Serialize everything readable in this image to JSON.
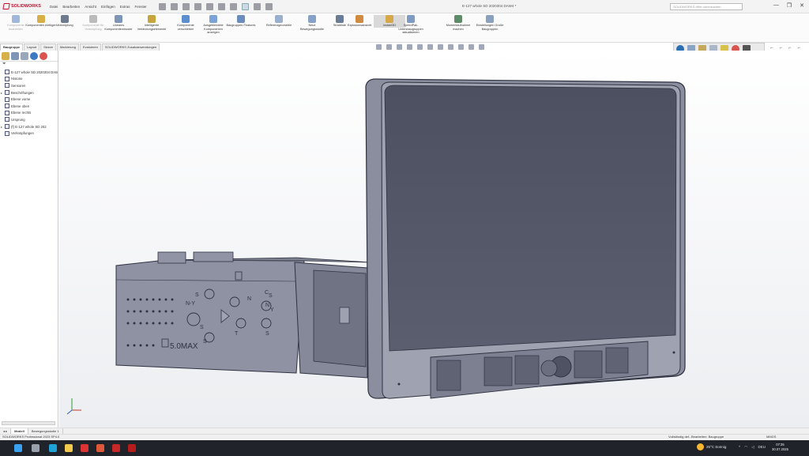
{
  "app": {
    "brand": "SOLIDWORKS",
    "menus": [
      "Datei",
      "Bearbeiten",
      "Ansicht",
      "Einfügen",
      "Extras",
      "Fenster"
    ],
    "document_title": "E-127 whole SD 2020304 DAW4 *",
    "search_placeholder": "SOLIDWORKS-Hilfe durchsuchen",
    "window_controls": [
      "—",
      "❐",
      "✕"
    ]
  },
  "command_manager": {
    "tools": [
      {
        "label": "Komponente bearbeiten",
        "disabled": true,
        "color": "#9fb7d9"
      },
      {
        "label": "Komponenten einfügen",
        "disabled": false,
        "color": "#d8b04a"
      },
      {
        "label": "Verknüpfung",
        "disabled": false,
        "color": "#6d7b91"
      },
      {
        "label": "Komponente für Verknüpfung",
        "disabled": true,
        "color": "#bbbbbb"
      },
      {
        "label": "Lineares Komponentenmuster",
        "disabled": false,
        "color": "#7f95b8"
      },
      {
        "label": "Intelligente Verbindungselemente",
        "disabled": false,
        "color": "#c7a53c"
      },
      {
        "label": "Komponente verschieben",
        "disabled": false,
        "color": "#5b8fcf"
      },
      {
        "label": "Ausgeblendete Komponenten anzeigen",
        "disabled": false,
        "color": "#7aa3d8"
      },
      {
        "label": "Baugruppen-Features",
        "disabled": false,
        "color": "#6a8dbe"
      },
      {
        "label": "Referenzgeometrie",
        "disabled": false,
        "color": "#9ab0cf"
      },
      {
        "label": "Neue Bewegungsstudie",
        "disabled": false,
        "color": "#87a2c7"
      },
      {
        "label": "Stückliste",
        "disabled": false,
        "color": "#6a7d96"
      },
      {
        "label": "Explosionsansicht",
        "disabled": false,
        "color": "#d08b3e"
      },
      {
        "label": "Instant3D",
        "disabled": false,
        "active": true,
        "color": "#d6a84a"
      },
      {
        "label": "SpeedPak-Untersbaugruppen aktualisieren",
        "disabled": false,
        "color": "#7f9bc2"
      },
      {
        "label": "Momentaufnahme machen",
        "disabled": false,
        "color": "#5e8c6a"
      },
      {
        "label": "Einstellungen Große Baugruppen",
        "disabled": false,
        "color": "#8aa0bf"
      }
    ]
  },
  "tabs": [
    "Baugruppe",
    "Layout",
    "Skizze",
    "Markierung",
    "Evaluieren",
    "SOLIDWORKS Zusatzanwendungen"
  ],
  "feature_tree": {
    "items": [
      {
        "label": "E-127 whole SD 2020304 DAW",
        "icon": "assembly-icon",
        "caret": ""
      },
      {
        "label": "Historie",
        "icon": "history-icon",
        "caret": ""
      },
      {
        "label": "Sensoren",
        "icon": "sensor-icon",
        "caret": ""
      },
      {
        "label": "Beschriftungen",
        "icon": "annotation-icon",
        "caret": "▸"
      },
      {
        "label": "Ebene vorne",
        "icon": "plane-icon",
        "caret": ""
      },
      {
        "label": "Ebene oben",
        "icon": "plane-icon",
        "caret": ""
      },
      {
        "label": "Ebene rechts",
        "icon": "plane-icon",
        "caret": ""
      },
      {
        "label": "Ursprung",
        "icon": "origin-icon",
        "caret": ""
      },
      {
        "label": "(f) E-127 whole SD 202",
        "icon": "part-icon",
        "caret": "▸"
      },
      {
        "label": "Verknüpfungen",
        "icon": "mates-icon",
        "caret": ""
      }
    ]
  },
  "bottom_tabs": [
    "Modell",
    "Bewegungsstudie 1"
  ],
  "status": {
    "version": "SOLIDWORKS Professional 2023 SP4.0",
    "defined": "Vollständig def...",
    "mode": "Bearbeiten: Baugruppe",
    "units": "MMGS"
  },
  "taskbar": {
    "weather": "25°C Sonnig",
    "lang": "DEU",
    "time": "07:35",
    "date": "30.07.2025",
    "apps": [
      {
        "name": "windows-start-icon",
        "color": "#3aa0f0"
      },
      {
        "name": "task-view-icon",
        "color": "#9aa0aa"
      },
      {
        "name": "edge-icon",
        "color": "#1fa2d8"
      },
      {
        "name": "explorer-icon",
        "color": "#f2c94c"
      },
      {
        "name": "solidworks-icon",
        "color": "#d33"
      },
      {
        "name": "app-icon",
        "color": "#e0583a"
      },
      {
        "name": "solidworks-2-icon",
        "color": "#c62828"
      },
      {
        "name": "solidworks-3-icon",
        "color": "#b71c1c"
      }
    ]
  },
  "model": {
    "labels": [
      "S",
      "N-Y",
      "S",
      "S",
      "N",
      "T",
      "C",
      "S",
      "N",
      "Y",
      "S"
    ],
    "max_label": "5.0MAX"
  }
}
